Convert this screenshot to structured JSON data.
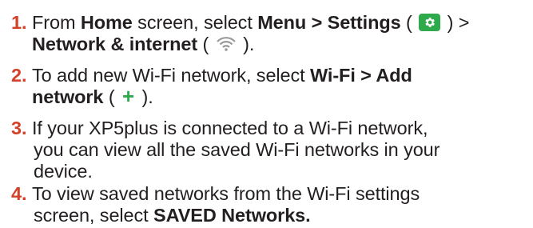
{
  "steps": [
    {
      "number": "1.",
      "from": "From ",
      "home": "Home",
      "screen_select": " screen, select ",
      "menu_settings": "Menu > Settings",
      "open_paren": " ( ",
      "close_paren_gt": " ) >",
      "network_internet": "Network & internet",
      "open_paren2": " ( ",
      "close_paren_end": " )."
    },
    {
      "number": "2.",
      "text_a": "To add new Wi-Fi network, select ",
      "wifi_add": "Wi-Fi > Add",
      "network": "network",
      "open_paren": " ( ",
      "close_paren_end": " )."
    },
    {
      "number": "3.",
      "line1": "If your XP5plus is connected to a Wi-Fi network,",
      "line2": "you can view all the saved Wi-Fi networks in your",
      "line3": "device."
    },
    {
      "number": "4.",
      "line1": "To view saved networks from the Wi-Fi settings",
      "line2_a": "screen, select ",
      "saved_networks": "SAVED Networks."
    }
  ],
  "icons": {
    "settings": "gear-icon",
    "network": "wifi-icon",
    "add": "plus-icon"
  },
  "colors": {
    "step_number": "#d4412a",
    "icon_green": "#2eaa4c",
    "text": "#231f20"
  }
}
